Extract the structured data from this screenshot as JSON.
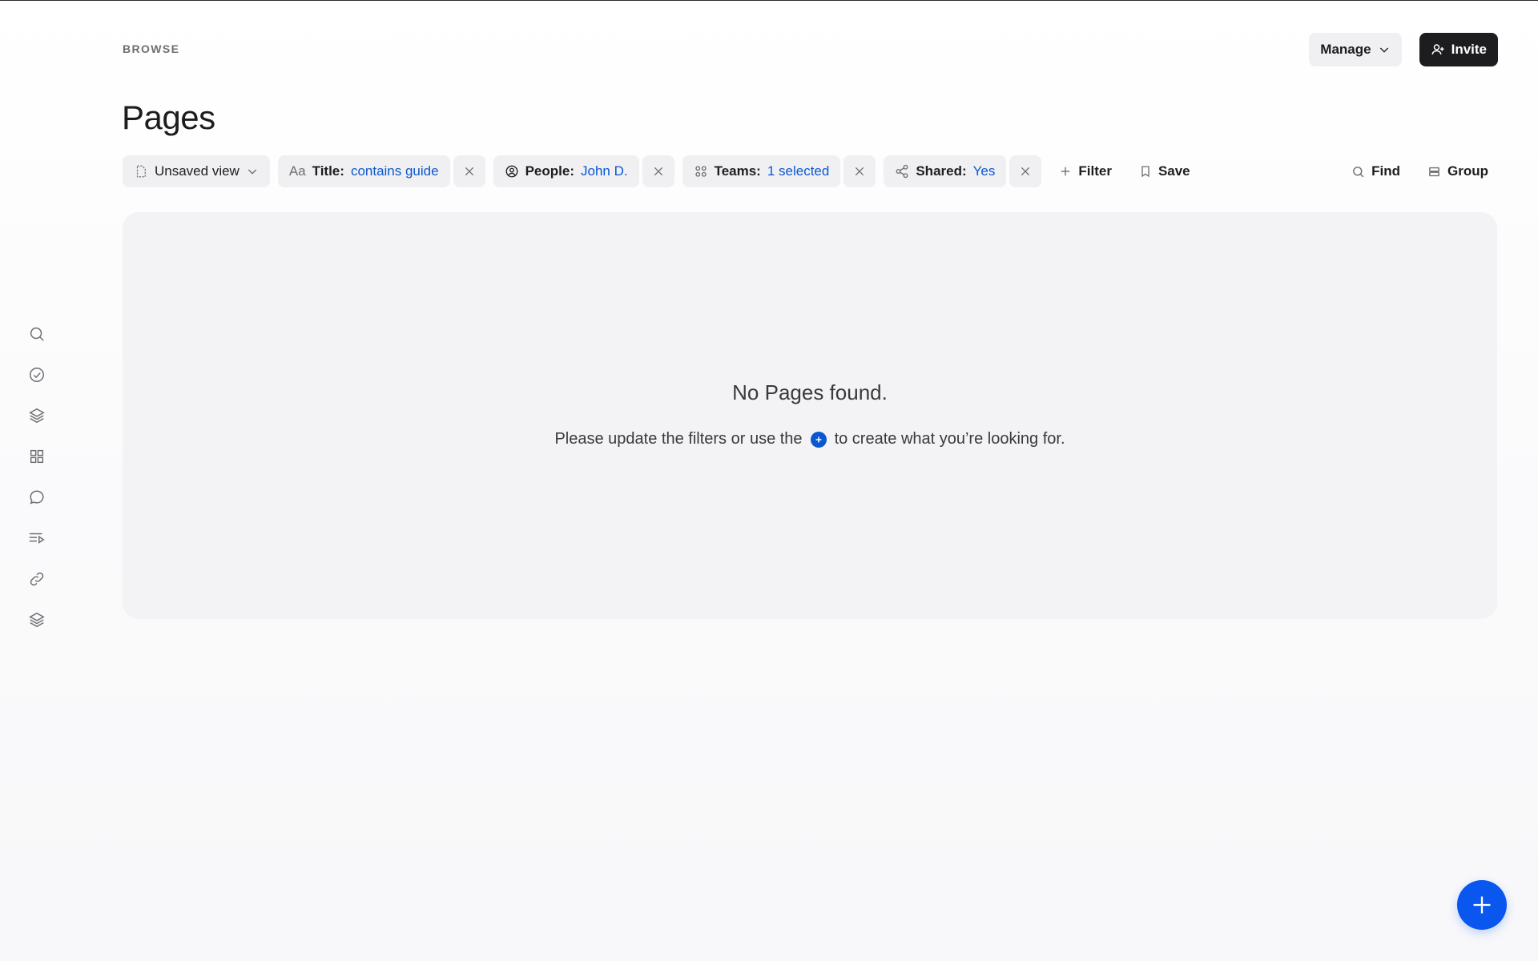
{
  "header": {
    "breadcrumb": "BROWSE",
    "title": "Pages",
    "manage_label": "Manage",
    "invite_label": "Invite"
  },
  "sidebar": {
    "icons": [
      "search-icon",
      "check-circle-icon",
      "layers-icon",
      "grid-icon",
      "chat-bubble-icon",
      "playlist-icon",
      "link-icon",
      "stack-icon"
    ]
  },
  "filters": {
    "view": {
      "label": "Unsaved view"
    },
    "title_filter": {
      "icon_text": "Aa",
      "key": "Title:",
      "value": "contains guide"
    },
    "people_filter": {
      "key": "People:",
      "value": "John D."
    },
    "teams_filter": {
      "key": "Teams:",
      "value": "1 selected"
    },
    "shared_filter": {
      "key": "Shared:",
      "value": "Yes"
    },
    "filter_label": "Filter",
    "save_label": "Save",
    "find_label": "Find",
    "group_label": "Group"
  },
  "empty_state": {
    "title": "No Pages found.",
    "sub_before": "Please update the filters or use the",
    "sub_after": "to create what you’re looking for."
  },
  "colors": {
    "accent": "#0a57f0",
    "link": "#0b57d0",
    "dark_button": "#1d1d1f"
  }
}
